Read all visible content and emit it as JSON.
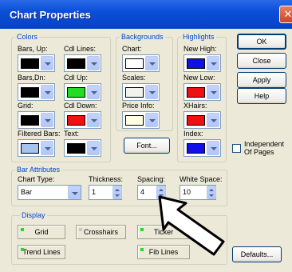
{
  "window": {
    "title": "Chart Properties",
    "close_glyph": "✕"
  },
  "colors": {
    "title": "Colors",
    "items": [
      {
        "label": "Bars, Up:",
        "color": "#000000"
      },
      {
        "label": "Cdl Lines:",
        "color": "#000000"
      },
      {
        "label": "Bars,Dn:",
        "color": "#000000"
      },
      {
        "label": "Cdl Up:",
        "color": "#22dd22"
      },
      {
        "label": "Grid:",
        "color": "#000000"
      },
      {
        "label": "Cdl Down:",
        "color": "#ee1111"
      },
      {
        "label": "Filtered Bars:",
        "color": "#a6c4ec"
      },
      {
        "label": "Text:",
        "color": "#000000"
      }
    ]
  },
  "backgrounds": {
    "title": "Backgrounds",
    "items": [
      {
        "label": "Chart:",
        "color": "#ffffff"
      },
      {
        "label": "Scales:",
        "color": "#f2f2ee"
      },
      {
        "label": "Price Info:",
        "color": "#ffffe2"
      }
    ],
    "font_button": "Font..."
  },
  "highlights": {
    "title": "Highlights",
    "items": [
      {
        "label": "New High:",
        "color": "#1010e8"
      },
      {
        "label": "New Low:",
        "color": "#ee1111"
      },
      {
        "label": "XHairs:",
        "color": "#ee1111"
      },
      {
        "label": "Index:",
        "color": "#1010e8"
      }
    ]
  },
  "buttons": {
    "ok": "OK",
    "close": "Close",
    "apply": "Apply",
    "help": "Help",
    "defaults": "Defaults..."
  },
  "independent": {
    "line1": "Independent",
    "line2": "Of Pages",
    "checked": false
  },
  "bar_attributes": {
    "title": "Bar Attributes",
    "chart_type_label": "Chart Type:",
    "chart_type_value": "Bar",
    "thickness_label": "Thickness:",
    "thickness_value": "1",
    "spacing_label": "Spacing:",
    "spacing_value": "4",
    "white_space_label": "White Space:",
    "white_space_value": "10"
  },
  "display": {
    "title": "Display",
    "grid": "Grid",
    "crosshairs": "Crosshairs",
    "ticker": "Ticker",
    "trend_lines": "Trend Lines",
    "fib_lines": "Fib Lines"
  },
  "led_on_color": "#22dd22",
  "led_off_color": "#c8c8c8"
}
